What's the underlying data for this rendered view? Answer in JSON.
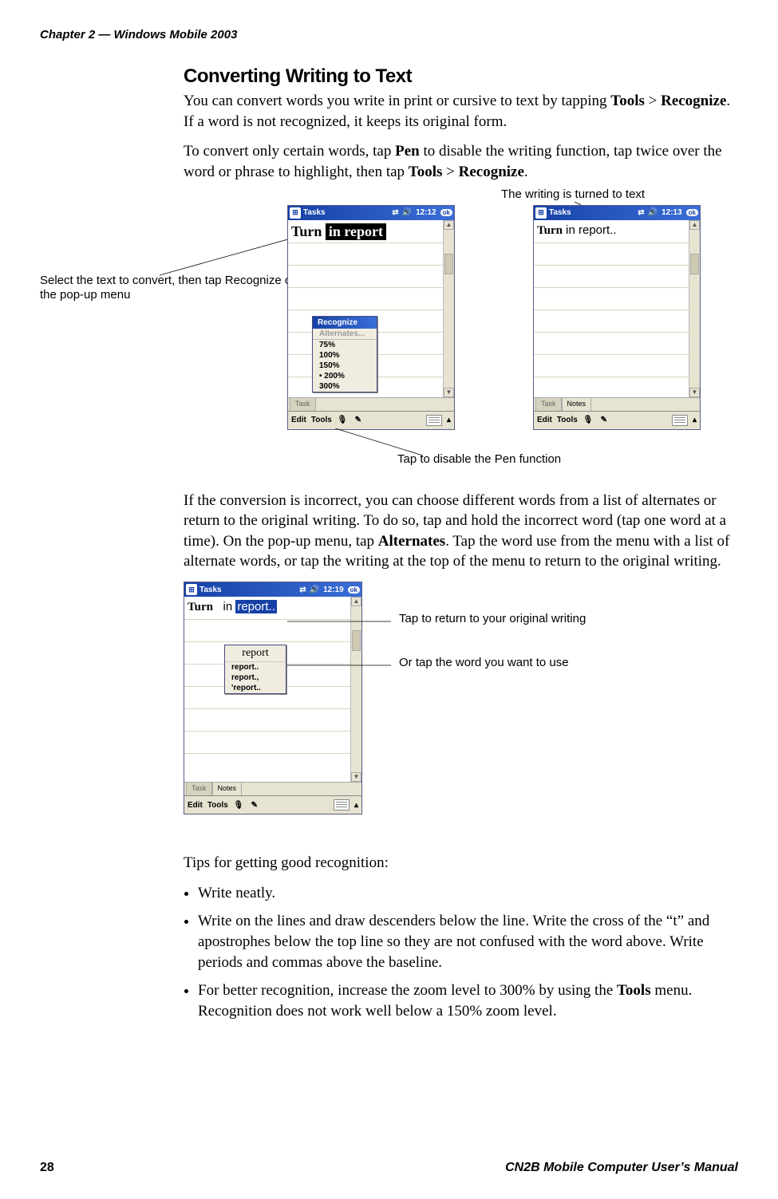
{
  "runningHead": "Chapter 2 — Windows Mobile 2003",
  "sectionTitle": "Converting Writing to Text",
  "para1_a": "You can convert words you write in print or cursive to text by tapping ",
  "para1_b": " > ",
  "para1_tools": "Tools",
  "para1_recognize": "Recognize",
  "para1_c": ". If a word is not recognized, it keeps its original form.",
  "para2_a": "To convert only certain words, tap ",
  "para2_pen": "Pen",
  "para2_b": " to disable the writing function, tap twice over the word or phrase to highlight, then tap ",
  "para2_tools": "Tools",
  "para2_gt": " > ",
  "para2_recognize": "Recognize",
  "para2_c": ".",
  "callouts": {
    "topRight": "The writing is turned to text",
    "left": "Select the text to convert, then tap Recognize on the pop-up menu",
    "bottom": "Tap to disable the Pen function",
    "returnOrig": "Tap to return to your original writing",
    "tapWord": "Or tap the word you want to use"
  },
  "pda": {
    "appTitle": "Tasks",
    "ok": "ok",
    "time1": "12:12",
    "time2": "12:13",
    "time3": "12:19",
    "tabs": {
      "task": "Task",
      "notes": "Notes"
    },
    "menu": {
      "edit": "Edit",
      "tools": "Tools"
    },
    "handwritten_turn": "Turn",
    "handwritten_sel": "in report",
    "typed_text_a": "Turn",
    "typed_text_b": "  in report..",
    "typed_sel": "report..",
    "recognizeMenu": {
      "header": "Recognize",
      "alternates": "Alternates...",
      "z75": "75%",
      "z100": "100%",
      "z150": "150%",
      "z200": "200%",
      "z300": "300%"
    },
    "altMenu": {
      "hw": "report",
      "o1": "report..",
      "o2": "report.,",
      "o3": "'report.."
    }
  },
  "para3_a": "If the conversion is incorrect, you can choose different words from a list of alternates or return to the original writing. To do so, tap and hold the incorrect word (tap one word at a time). On the pop-up menu, tap ",
  "para3_alternates": "Alternates",
  "para3_b": ". Tap the word use from the menu with a list of alternate words, or tap the writing at the top of the menu to return to the original writing.",
  "tipsIntro": "Tips for getting good recognition:",
  "tips": {
    "t1": "Write neatly.",
    "t2": "Write on the lines and draw descenders below the line. Write the cross of the “t” and apostrophes below the top line so they are not confused with the word above. Write periods and commas above the baseline.",
    "t3_a": "For better recognition, increase the zoom level to 300% by using the ",
    "t3_tools": "Tools",
    "t3_b": " menu. Recognition does not work well below a 150% zoom level."
  },
  "footer": {
    "page": "28",
    "manual": "CN2B Mobile Computer User’s Manual"
  }
}
